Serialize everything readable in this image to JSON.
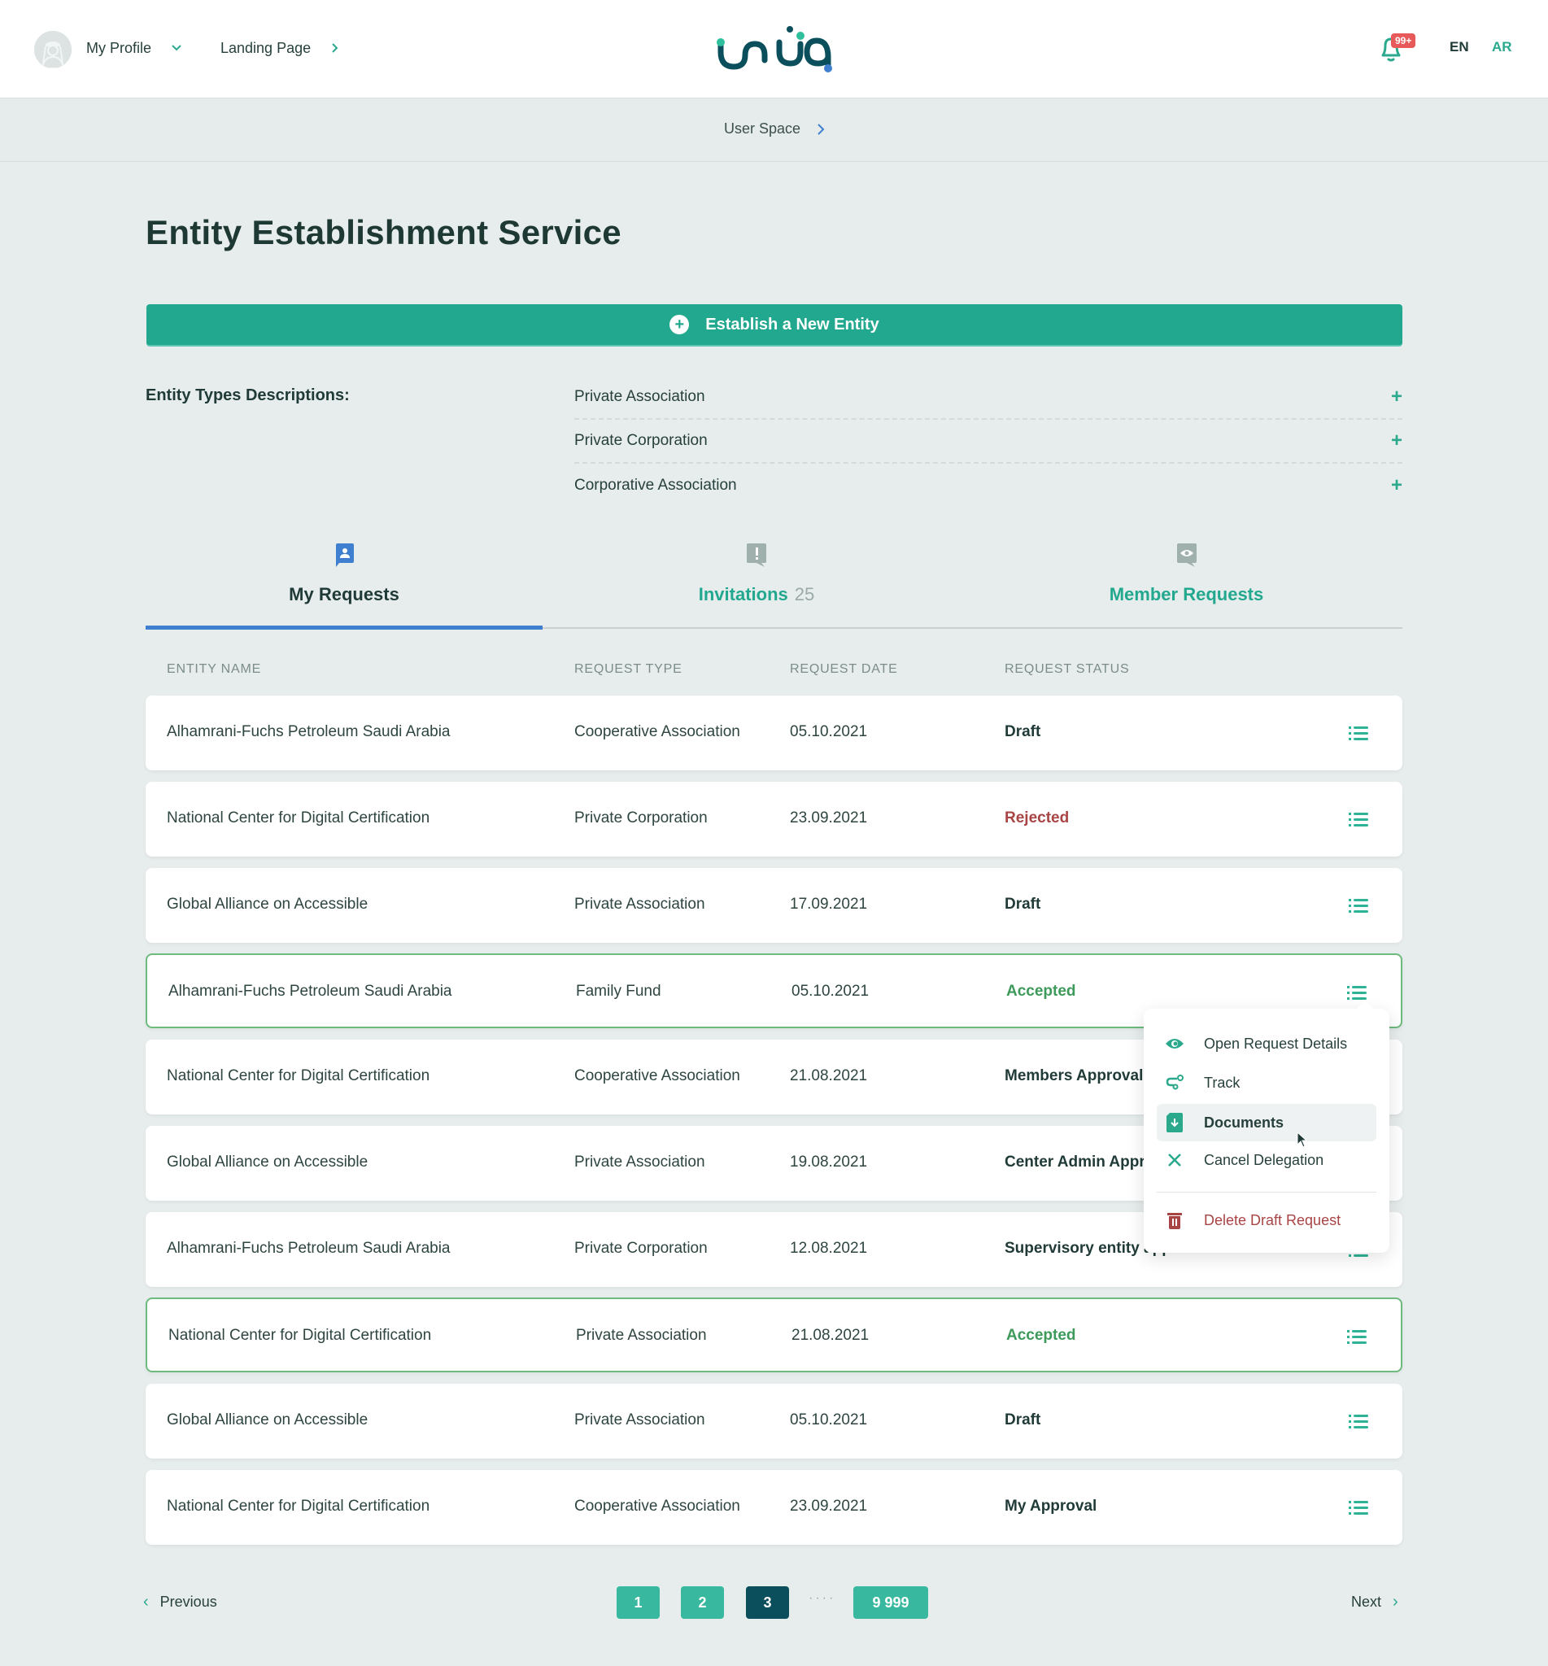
{
  "header": {
    "profile_label": "My Profile",
    "landing_label": "Landing Page",
    "logo_alt": "unuq logo",
    "notification_badge": "99+",
    "lang_en": "EN",
    "lang_ar": "AR"
  },
  "breadcrumb": {
    "label": "User Space"
  },
  "page": {
    "title": "Entity Establishment Service",
    "establish_button": "Establish a New Entity"
  },
  "entity_types": {
    "label": "Entity Types Descriptions:",
    "items": [
      {
        "label": "Private Association"
      },
      {
        "label": "Private Corporation"
      },
      {
        "label": "Corporative Association"
      }
    ]
  },
  "tabs": [
    {
      "label": "My Requests",
      "icon": "user-chat-icon",
      "active": true
    },
    {
      "label": "Invitations",
      "count": "25",
      "icon": "alert-chat-icon",
      "active": false
    },
    {
      "label": "Member Requests",
      "icon": "eye-chat-icon",
      "active": false
    }
  ],
  "table": {
    "columns": [
      "ENTITY NAME",
      "REQUEST TYPE",
      "REQUEST DATE",
      "REQUEST STATUS"
    ],
    "rows": [
      {
        "name": "Alhamrani-Fuchs Petroleum Saudi Arabia",
        "type": "Cooperative Association",
        "date": "05.10.2021",
        "status": "Draft",
        "status_kind": "draft"
      },
      {
        "name": "National Center for Digital Certification",
        "type": "Private Corporation",
        "date": "23.09.2021",
        "status": "Rejected",
        "status_kind": "rejected"
      },
      {
        "name": "Global Alliance on Accessible",
        "type": "Private Association",
        "date": "17.09.2021",
        "status": "Draft",
        "status_kind": "draft"
      },
      {
        "name": "Alhamrani-Fuchs Petroleum Saudi Arabia",
        "type": "Family Fund",
        "date": "05.10.2021",
        "status": "Accepted",
        "status_kind": "accepted"
      },
      {
        "name": "National Center for Digital Certification",
        "type": "Cooperative Association",
        "date": "21.08.2021",
        "status": "Members Approval",
        "status_kind": "pending"
      },
      {
        "name": "Global Alliance on Accessible",
        "type": "Private Association",
        "date": "19.08.2021",
        "status": "Center Admin Approval",
        "status_kind": "pending"
      },
      {
        "name": "Alhamrani-Fuchs Petroleum Saudi Arabia",
        "type": "Private Corporation",
        "date": "12.08.2021",
        "status": "Supervisory entity approval",
        "status_kind": "pending"
      },
      {
        "name": "National Center for Digital Certification",
        "type": "Private Association",
        "date": "21.08.2021",
        "status": "Accepted",
        "status_kind": "accepted"
      },
      {
        "name": "Global Alliance on Accessible",
        "type": "Private Association",
        "date": "05.10.2021",
        "status": "Draft",
        "status_kind": "draft"
      },
      {
        "name": "National Center for Digital Certification",
        "type": "Cooperative Association",
        "date": "23.09.2021",
        "status": "My Approval",
        "status_kind": "pending"
      }
    ]
  },
  "row_menu": {
    "open_for_row": 4,
    "items": [
      {
        "label": "Open Request Details",
        "icon": "eye-icon"
      },
      {
        "label": "Track",
        "icon": "route-icon"
      },
      {
        "label": "Documents",
        "icon": "document-download-icon",
        "hovered": true
      },
      {
        "label": "Cancel Delegation",
        "icon": "close-icon"
      },
      {
        "label": "Delete Draft Request",
        "icon": "trash-icon",
        "danger": true
      }
    ]
  },
  "pagination": {
    "previous": "Previous",
    "next": "Next",
    "pages": [
      "1",
      "2",
      "3"
    ],
    "ellipsis": "····",
    "last_page": "9 999",
    "current_page": "3"
  },
  "colors": {
    "primary": "#22a88e",
    "active_tab": "#3f7fd0",
    "rejected": "#a94445",
    "accepted": "#3d9a5a",
    "current_page": "#0b4e5c",
    "badge": "#e85a5a"
  }
}
